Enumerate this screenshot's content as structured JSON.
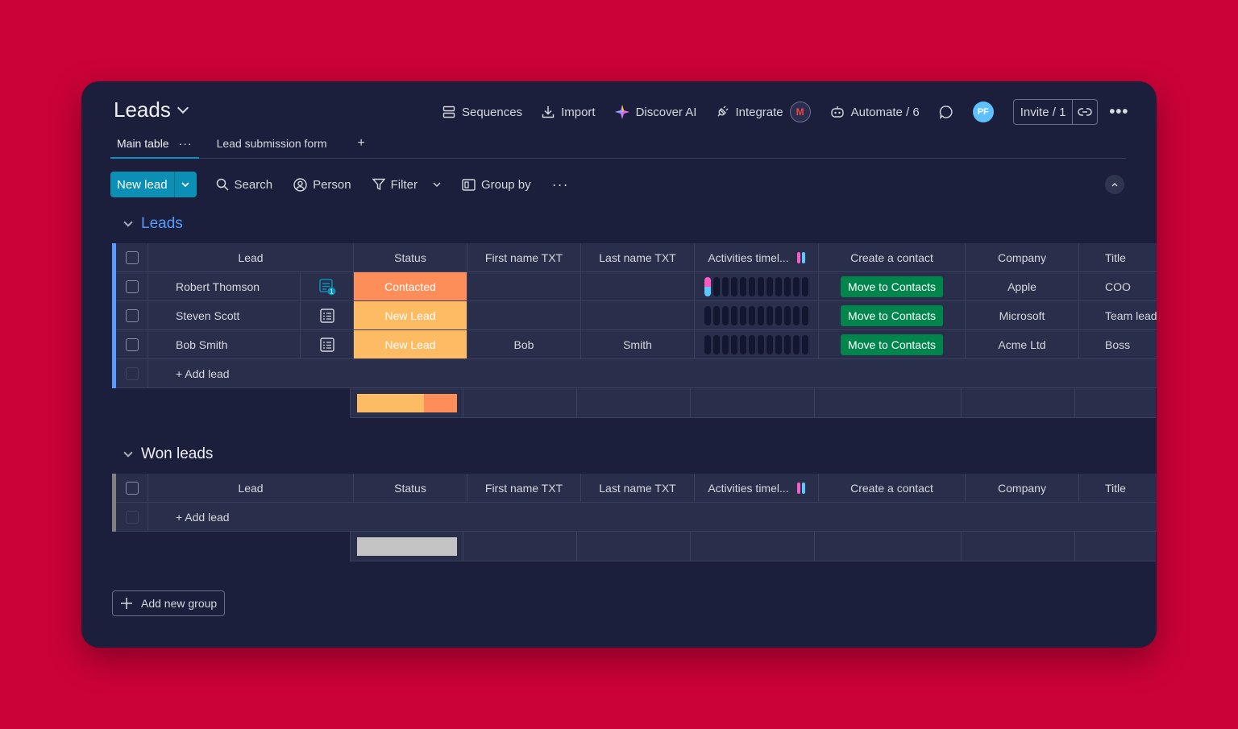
{
  "board": {
    "title": "Leads"
  },
  "top_actions": {
    "sequences": "Sequences",
    "import": "Import",
    "discover_ai": "Discover AI",
    "integrate": "Integrate",
    "automate": "Automate / 6",
    "avatar_initials": "PF",
    "invite": "Invite / 1"
  },
  "tabs": [
    {
      "label": "Main table",
      "active": true
    },
    {
      "label": "Lead submission form",
      "active": false
    }
  ],
  "toolbar": {
    "new_item": "New lead",
    "search": "Search",
    "person": "Person",
    "filter": "Filter",
    "group_by": "Group by"
  },
  "columns": {
    "lead": "Lead",
    "status": "Status",
    "first_name": "First name TXT",
    "last_name": "Last name TXT",
    "activities": "Activities timel...",
    "create_contact": "Create a contact",
    "company": "Company",
    "title": "Title"
  },
  "groups": [
    {
      "title": "Leads",
      "color": "#579bfc",
      "add_label": "+ Add lead",
      "rows": [
        {
          "lead": "Robert Thomson",
          "status": "Contacted",
          "status_color": "#fd8e59",
          "first_name": "",
          "last_name": "",
          "action": "Move to Contacts",
          "company": "Apple",
          "title": "COO",
          "updates": "1"
        },
        {
          "lead": "Steven Scott",
          "status": "New Lead",
          "status_color": "#fdbc64",
          "first_name": "",
          "last_name": "",
          "action": "Move to Contacts",
          "company": "Microsoft",
          "title": "Team lead"
        },
        {
          "lead": "Bob Smith",
          "status": "New Lead",
          "status_color": "#fdbc64",
          "first_name": "Bob",
          "last_name": "Smith",
          "action": "Move to Contacts",
          "company": "Acme Ltd",
          "title": "Boss"
        }
      ],
      "status_summary": [
        {
          "color": "#fdbc64",
          "share": 0.67
        },
        {
          "color": "#fd8e59",
          "share": 0.33
        }
      ]
    },
    {
      "title": "Won leads",
      "color": "#808080",
      "add_label": "+ Add lead",
      "rows": [],
      "status_summary": [
        {
          "color": "#c4c4c4",
          "share": 1.0
        }
      ]
    }
  ],
  "add_group": "Add new group"
}
